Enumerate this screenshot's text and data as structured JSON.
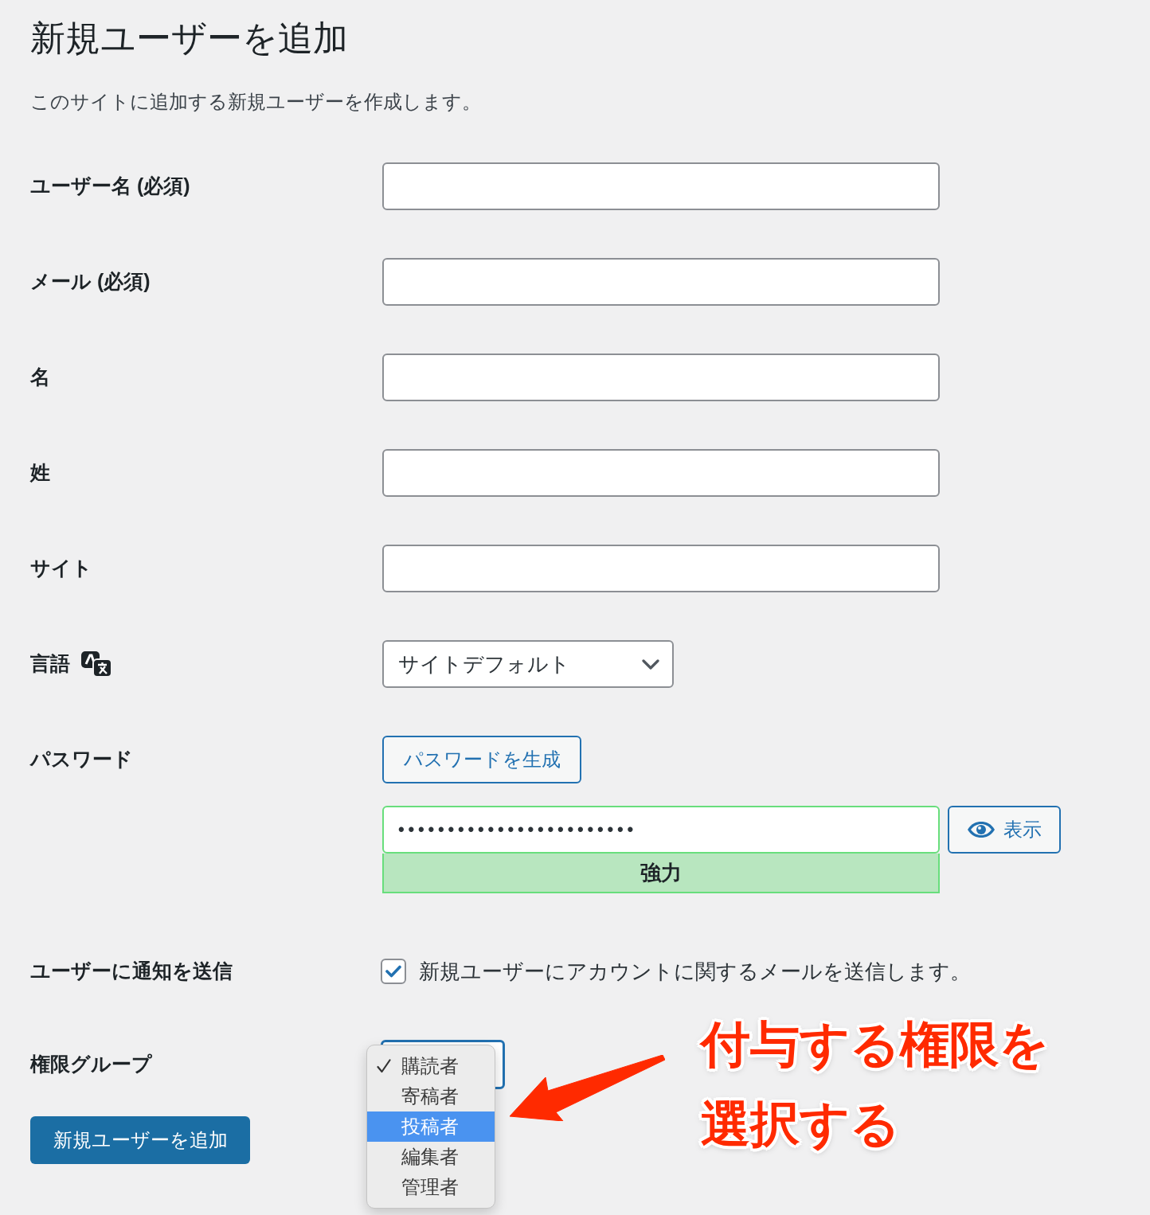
{
  "page": {
    "title": "新規ユーザーを追加",
    "description": "このサイトに追加する新規ユーザーを作成します。"
  },
  "fields": [
    {
      "kind": "text",
      "label": "ユーザー名 (必須)"
    },
    {
      "kind": "text",
      "label": "メール (必須)"
    },
    {
      "kind": "text",
      "label": "名"
    },
    {
      "kind": "text",
      "label": "姓"
    },
    {
      "kind": "text",
      "label": "サイト"
    },
    {
      "kind": "language",
      "label": "言語",
      "value": "サイトデフォルト"
    },
    {
      "kind": "password",
      "label": "パスワード",
      "generate_button": "パスワードを生成",
      "value": "••••••••••••••••••••••••",
      "show_button": "表示",
      "strength_meter": {
        "kind": "strong",
        "label": "強力"
      }
    },
    {
      "kind": "checkbox",
      "label": "ユーザーに通知を送信",
      "checked": true,
      "text": "新規ユーザーにアカウントに関するメールを送信します。"
    },
    {
      "kind": "role",
      "label": "権限グループ",
      "expanded": true,
      "options": [
        {
          "label": "購読者",
          "selected": true,
          "highlighted": false
        },
        {
          "label": "寄稿者",
          "selected": false,
          "highlighted": false
        },
        {
          "label": "投稿者",
          "selected": false,
          "highlighted": true
        },
        {
          "label": "編集者",
          "selected": false,
          "highlighted": false
        },
        {
          "label": "管理者",
          "selected": false,
          "highlighted": false
        }
      ]
    }
  ],
  "submit_button": "新規ユーザーを追加",
  "annotation": {
    "text": "付与する権限を選択する"
  }
}
